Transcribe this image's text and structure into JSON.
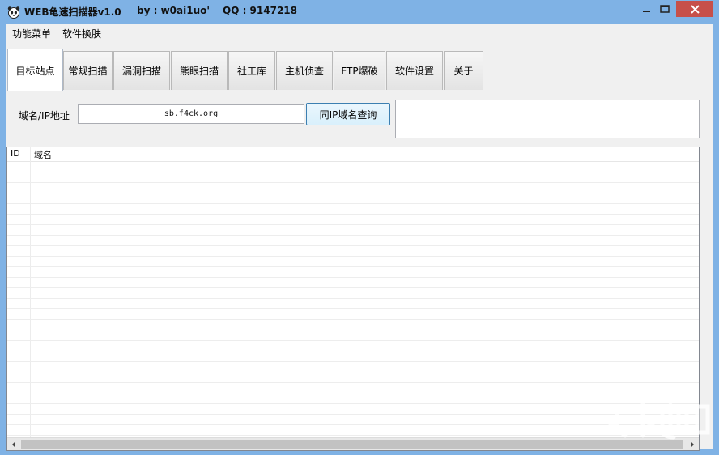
{
  "window": {
    "title": "WEB龟速扫描器v1.0",
    "author": "by : w0ai1uo'",
    "qq": "QQ : 9147218"
  },
  "menu": {
    "items": [
      {
        "label": "功能菜单"
      },
      {
        "label": "软件换肤"
      }
    ]
  },
  "tabs": [
    {
      "label": "目标站点",
      "active": true
    },
    {
      "label": "常规扫描"
    },
    {
      "label": "漏洞扫描"
    },
    {
      "label": "熊眼扫描"
    },
    {
      "label": "社工库"
    },
    {
      "label": "主机侦查"
    },
    {
      "label": "FTP爆破"
    },
    {
      "label": "软件设置"
    },
    {
      "label": "关于"
    }
  ],
  "target": {
    "domain_label": "域名/IP地址",
    "domain_value": "sb.f4ck.org",
    "query_button": "同IP域名查询"
  },
  "table": {
    "columns": [
      "ID",
      "域名"
    ],
    "rows": []
  },
  "colors": {
    "titlebar": "#7fb2e5",
    "close_button": "#c7504a",
    "client_bg": "#f0f0f0"
  }
}
